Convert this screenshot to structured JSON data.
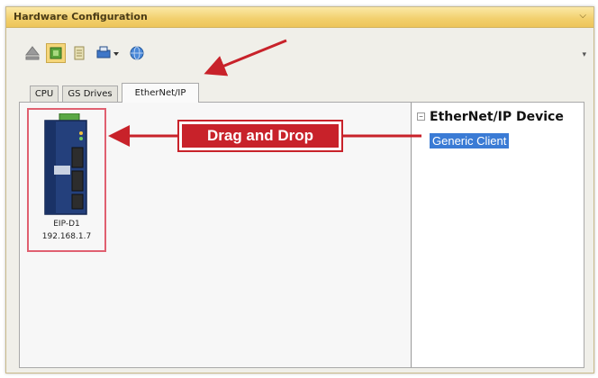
{
  "window": {
    "title": "Hardware Configuration",
    "title_menu_icon": "chevron-down-icon"
  },
  "toolbar": {
    "icons": [
      "eject-icon",
      "module-icon",
      "delete-icon",
      "print-dropdown-icon",
      "globe-icon"
    ],
    "overflow_icon": "chevron-down-icon"
  },
  "tabs": [
    {
      "label": "CPU",
      "active": false
    },
    {
      "label": "GS Drives",
      "active": false
    },
    {
      "label": "EtherNet/IP",
      "active": true
    }
  ],
  "device": {
    "name": "EIP-D1",
    "ip": "192.168.1.7"
  },
  "callout": {
    "text": "Drag and Drop",
    "color": "#c8222a"
  },
  "tree": {
    "root_label": "EtherNet/IP Device",
    "child_label": "Generic Client",
    "selection_color": "#3a7bd5"
  }
}
